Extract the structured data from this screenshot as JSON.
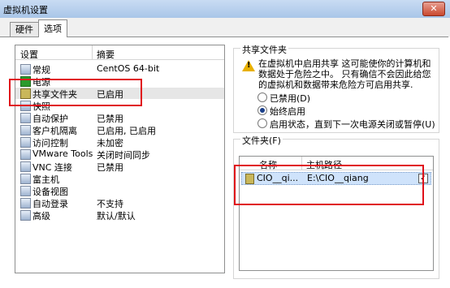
{
  "window": {
    "title": "虚拟机设置",
    "close_glyph": "✕"
  },
  "tabs": [
    {
      "label": "硬件"
    },
    {
      "label": "选项"
    }
  ],
  "settings_list": {
    "header": {
      "setting": "设置",
      "summary": "摘要"
    },
    "items": [
      {
        "name": "常规",
        "summary": "CentOS 64-bit"
      },
      {
        "name": "电源",
        "summary": ""
      },
      {
        "name": "共享文件夹",
        "summary": "已启用"
      },
      {
        "name": "快照",
        "summary": ""
      },
      {
        "name": "自动保护",
        "summary": "已禁用"
      },
      {
        "name": "客户机隔离",
        "summary": "已启用, 已启用"
      },
      {
        "name": "访问控制",
        "summary": "未加密"
      },
      {
        "name": "VMware Tools",
        "summary": "关闭时间同步"
      },
      {
        "name": "VNC 连接",
        "summary": "已禁用"
      },
      {
        "name": "富主机",
        "summary": ""
      },
      {
        "name": "设备视图",
        "summary": ""
      },
      {
        "name": "自动登录",
        "summary": "不支持"
      },
      {
        "name": "高级",
        "summary": "默认/默认"
      }
    ],
    "selected_index": 2
  },
  "shared_folders": {
    "legend": "共享文件夹",
    "warning_icon": "warning-icon",
    "warning_text": "在虚拟机中启用共享 这可能使你的计算机和数据处于危险之中。 只有确信不会因此给您的虚拟机和数据带来危险方可启用共享.",
    "options": [
      {
        "label": "已禁用(D)",
        "selected": false
      },
      {
        "label": "始终启用",
        "selected": true
      },
      {
        "label": "启用状态，直到下一次电源关闭或暂停(U)",
        "selected": false
      }
    ]
  },
  "folders": {
    "legend": "文件夹(F)",
    "columns": {
      "name": "名称",
      "host_path": "主机路径"
    },
    "rows": [
      {
        "name": "CIO__qi...",
        "host_path": "E:\\CIO__qiang",
        "checked": true
      }
    ],
    "check_glyph": "✓"
  },
  "annotation_color": "#e0101a"
}
